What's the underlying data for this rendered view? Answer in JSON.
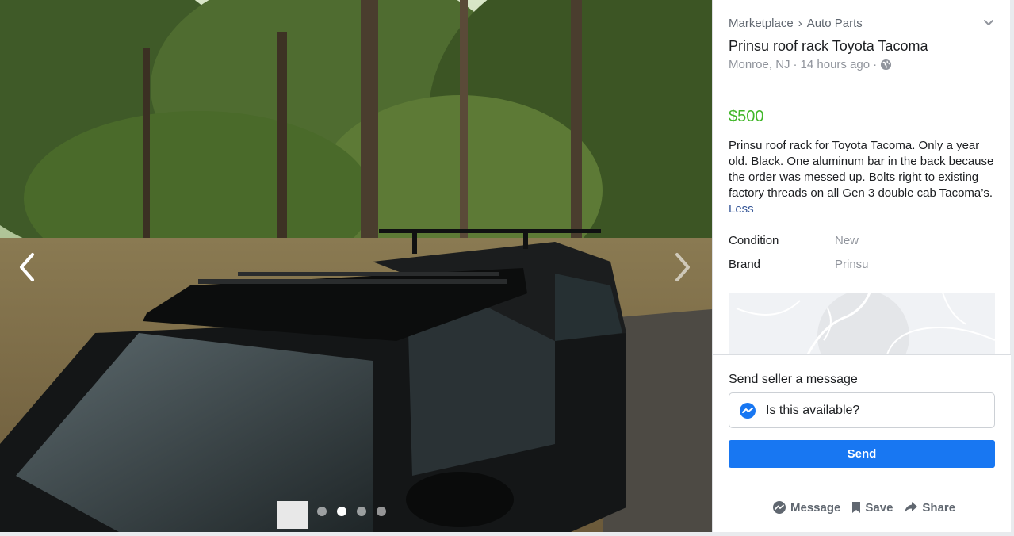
{
  "photo": {
    "image_label": "Black Toyota Tacoma pickup with roof rack parked in a wooded driveway",
    "slide_count": 4,
    "active_slide": 2
  },
  "listing": {
    "breadcrumb": [
      "Marketplace",
      "Auto Parts"
    ],
    "breadcrumb_separator": "›",
    "title": "Prinsu roof rack Toyota Tacoma",
    "location": "Monroe, NJ",
    "time_ago": "14 hours ago",
    "meta_sep": "·",
    "price": "$500",
    "description": "Prinsu roof rack for Toyota Tacoma. Only a year old. Black. One aluminum bar in the back because the order was messed up.  Bolts right to existing factory threads on all Gen 3 double cab Tacoma’s.",
    "less_link": "Less",
    "attributes": [
      {
        "key": "Condition",
        "value": "New"
      },
      {
        "key": "Brand",
        "value": "Prinsu"
      }
    ]
  },
  "message": {
    "label": "Send seller a message",
    "input_value": "Is this available?",
    "send_label": "Send"
  },
  "actions": {
    "message": "Message",
    "save": "Save",
    "share": "Share"
  },
  "colors": {
    "price": "#42b72a",
    "send_button": "#1877f2",
    "link": "#385898"
  }
}
